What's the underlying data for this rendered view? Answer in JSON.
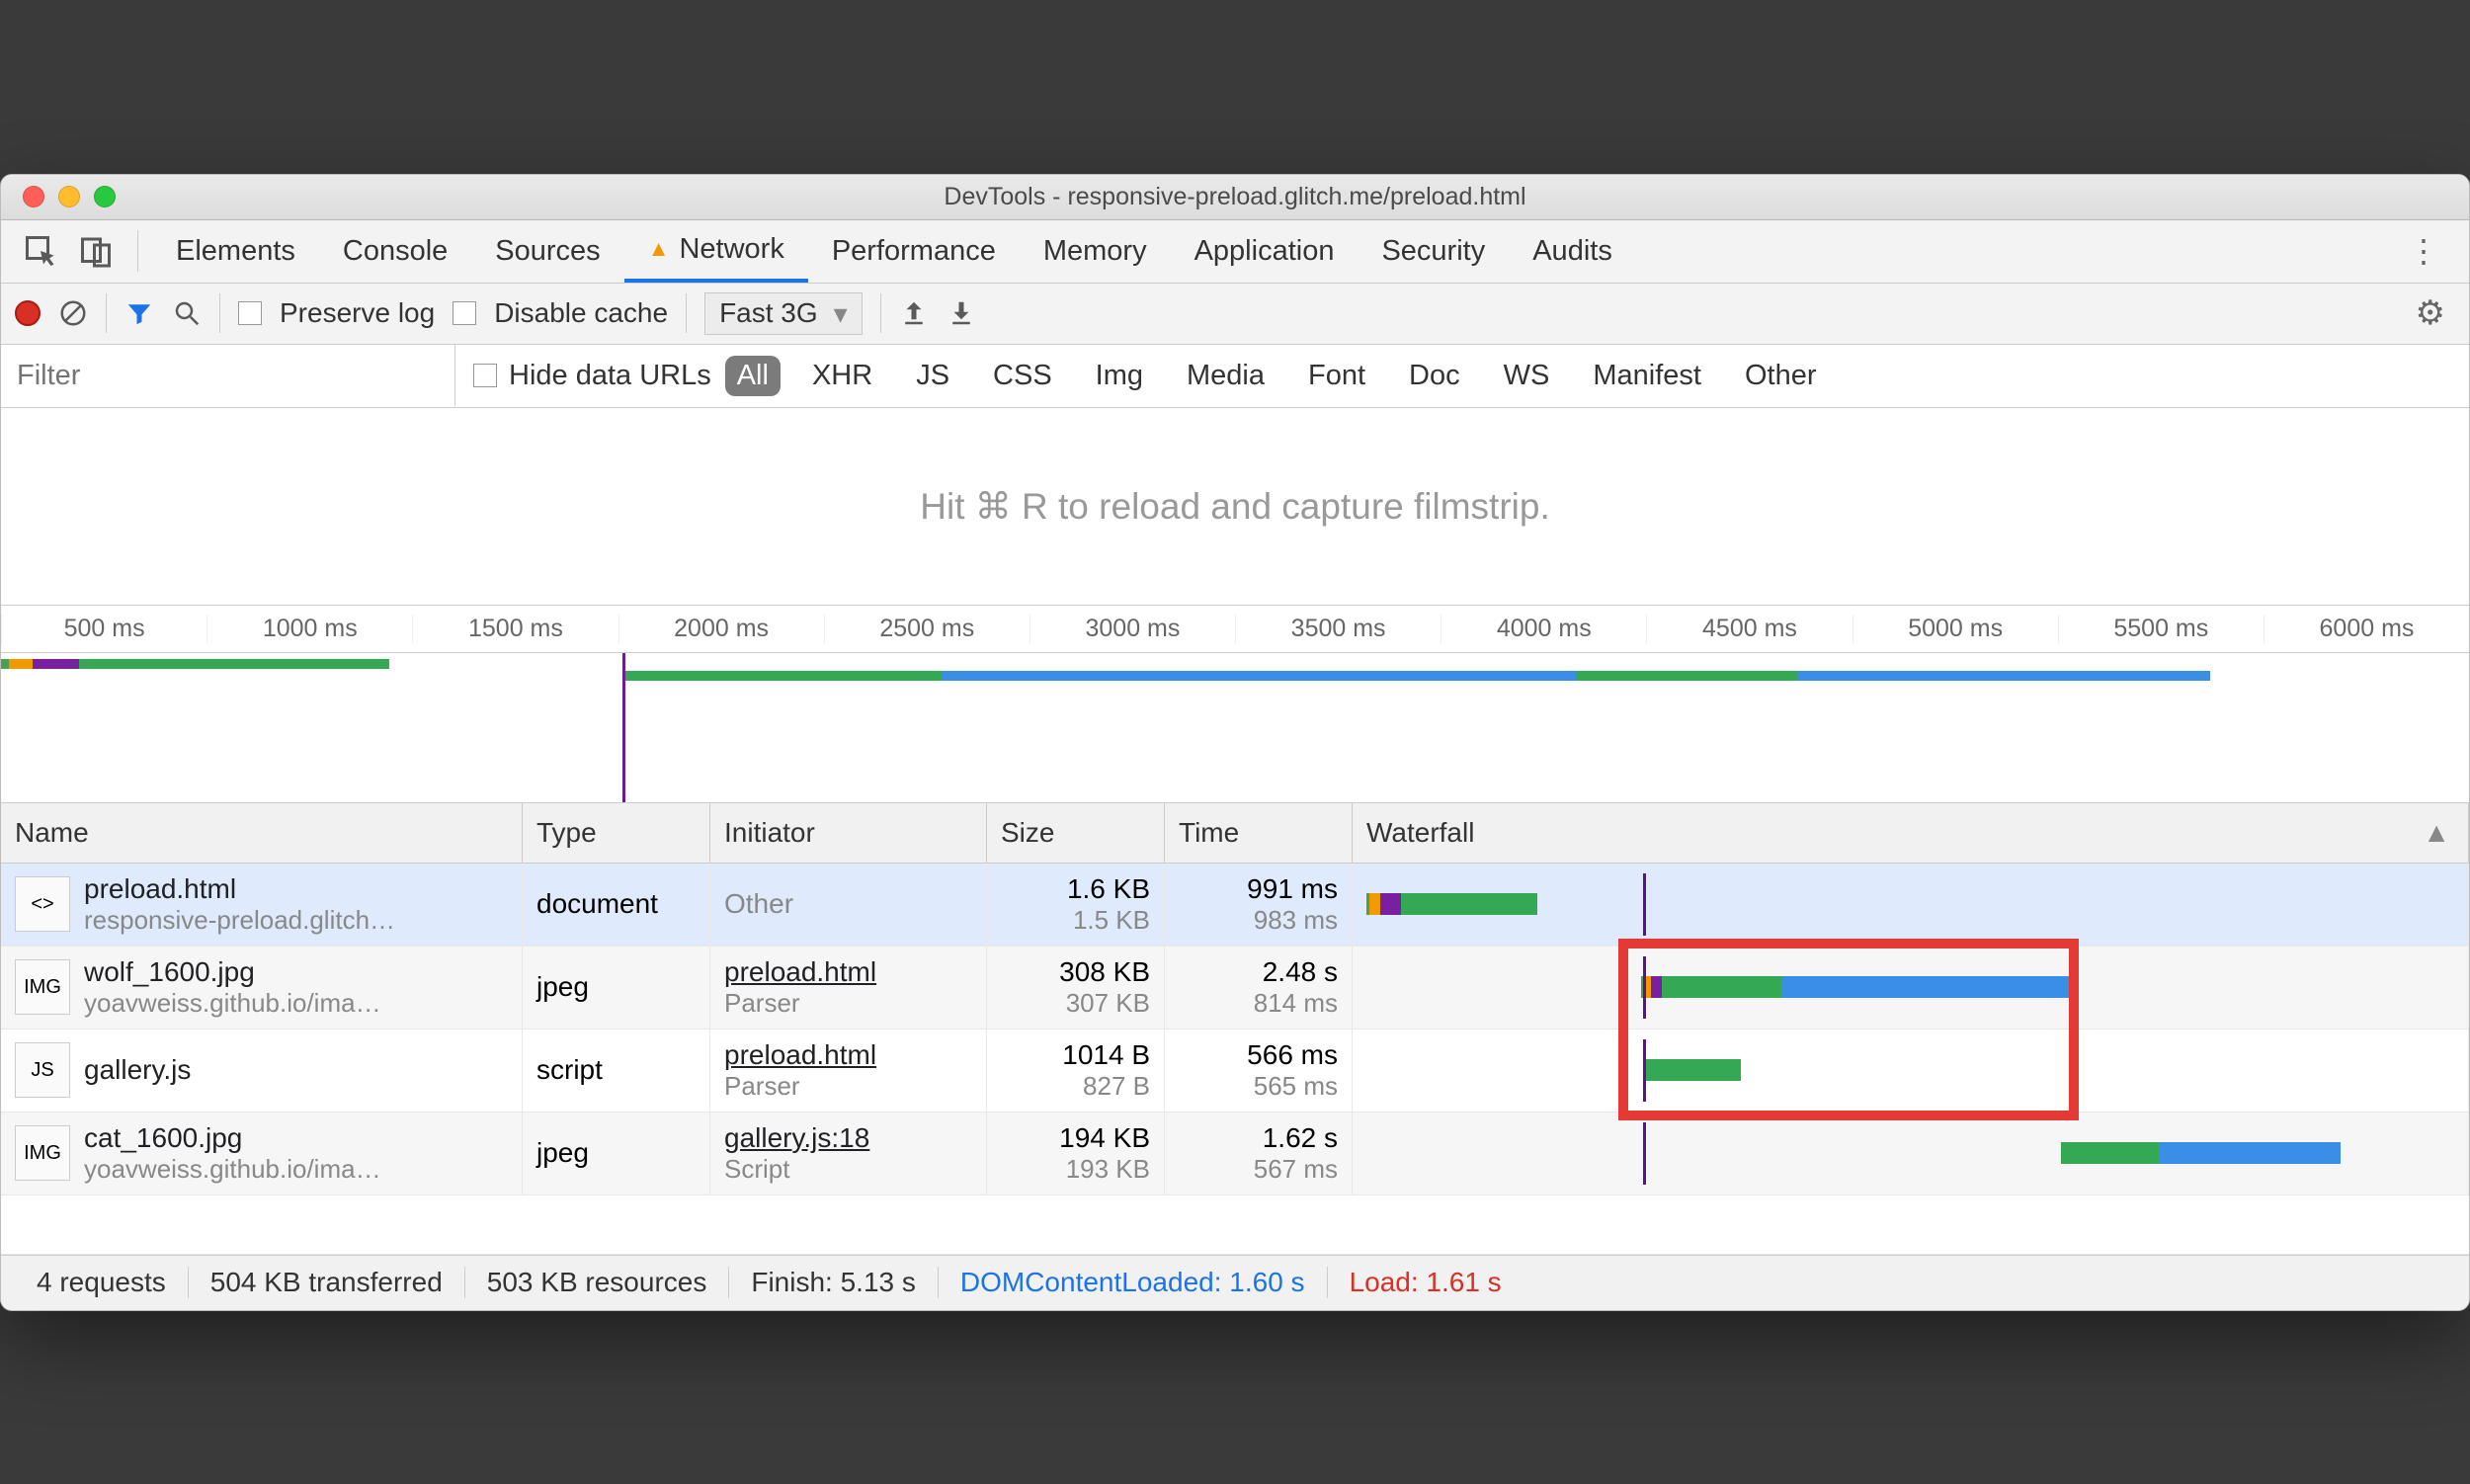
{
  "window": {
    "title": "DevTools - responsive-preload.glitch.me/preload.html"
  },
  "tabs": [
    "Elements",
    "Console",
    "Sources",
    "Network",
    "Performance",
    "Memory",
    "Application",
    "Security",
    "Audits"
  ],
  "active_tab": "Network",
  "toolbar": {
    "preserve_log": "Preserve log",
    "disable_cache": "Disable cache",
    "throttle": "Fast 3G"
  },
  "filter": {
    "placeholder": "Filter",
    "hide_data_urls": "Hide data URLs",
    "types": [
      "All",
      "XHR",
      "JS",
      "CSS",
      "Img",
      "Media",
      "Font",
      "Doc",
      "WS",
      "Manifest",
      "Other"
    ],
    "active_type": "All"
  },
  "filmstrip": "Hit ⌘ R to reload and capture filmstrip.",
  "timeline": {
    "ticks": [
      "500 ms",
      "1000 ms",
      "1500 ms",
      "2000 ms",
      "2500 ms",
      "3000 ms",
      "3500 ms",
      "4000 ms",
      "4500 ms",
      "5000 ms",
      "5500 ms",
      "6000 ms"
    ],
    "cursor_pct": 25.2
  },
  "columns": {
    "name": "Name",
    "type": "Type",
    "initiator": "Initiator",
    "size": "Size",
    "time": "Time",
    "waterfall": "Waterfall"
  },
  "requests": [
    {
      "icon": "<>",
      "name": "preload.html",
      "sub": "responsive-preload.glitch…",
      "type": "document",
      "initiator": "Other",
      "init_sub": "",
      "size": "1.6 KB",
      "size_sub": "1.5 KB",
      "time": "991 ms",
      "time_sub": "983 ms"
    },
    {
      "icon": "IMG",
      "name": "wolf_1600.jpg",
      "sub": "yoavweiss.github.io/ima…",
      "type": "jpeg",
      "initiator": "preload.html",
      "init_sub": "Parser",
      "size": "308 KB",
      "size_sub": "307 KB",
      "time": "2.48 s",
      "time_sub": "814 ms"
    },
    {
      "icon": "JS",
      "name": "gallery.js",
      "sub": "",
      "type": "script",
      "initiator": "preload.html",
      "init_sub": "Parser",
      "size": "1014 B",
      "size_sub": "827 B",
      "time": "566 ms",
      "time_sub": "565 ms"
    },
    {
      "icon": "IMG",
      "name": "cat_1600.jpg",
      "sub": "yoavweiss.github.io/ima…",
      "type": "jpeg",
      "initiator": "gallery.js:18",
      "init_sub": "Script",
      "size": "194 KB",
      "size_sub": "193 KB",
      "time": "1.62 s",
      "time_sub": "567 ms"
    }
  ],
  "footer": {
    "req": "4 requests",
    "transferred": "504 KB transferred",
    "resources": "503 KB resources",
    "finish": "Finish: 5.13 s",
    "dcl": "DOMContentLoaded: 1.60 s",
    "load": "Load: 1.61 s"
  },
  "chart_data": {
    "type": "table",
    "title": "Network waterfall",
    "x_unit": "ms",
    "x_range": [
      0,
      6300
    ],
    "dom_content_loaded_ms": 1600,
    "load_ms": 1610,
    "series": [
      {
        "name": "preload.html",
        "start_ms": 0,
        "duration_ms": 991,
        "phases": [
          {
            "color": "#4c9f4c",
            "ms": 20
          },
          {
            "color": "#f29900",
            "ms": 60
          },
          {
            "color": "#7b1fa2",
            "ms": 120
          },
          {
            "color": "#34a853",
            "ms": 791
          }
        ]
      },
      {
        "name": "wolf_1600.jpg",
        "start_ms": 1590,
        "duration_ms": 2480,
        "phases": [
          {
            "color": "#4c9f4c",
            "ms": 20
          },
          {
            "color": "#f29900",
            "ms": 40
          },
          {
            "color": "#7b1fa2",
            "ms": 60
          },
          {
            "color": "#34a853",
            "ms": 694
          },
          {
            "color": "#3b8ee6",
            "ms": 1666
          }
        ]
      },
      {
        "name": "gallery.js",
        "start_ms": 1600,
        "duration_ms": 566,
        "phases": [
          {
            "color": "#34a853",
            "ms": 566
          }
        ]
      },
      {
        "name": "cat_1600.jpg",
        "start_ms": 4020,
        "duration_ms": 1620,
        "phases": [
          {
            "color": "#34a853",
            "ms": 567
          },
          {
            "color": "#3b8ee6",
            "ms": 1053
          }
        ]
      }
    ]
  }
}
